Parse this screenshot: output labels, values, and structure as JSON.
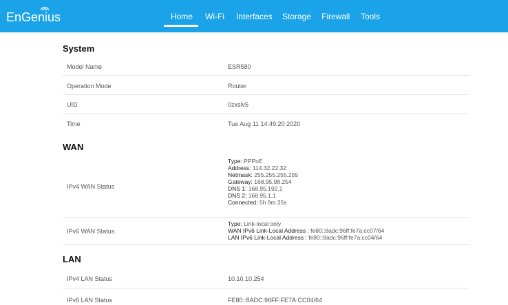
{
  "brand": {
    "logo_text": "EnGenius"
  },
  "nav": {
    "items": [
      {
        "label": "Home"
      },
      {
        "label": "Wi-Fi"
      },
      {
        "label": "Interfaces"
      },
      {
        "label": "Storage"
      },
      {
        "label": "Firewall"
      },
      {
        "label": "Tools"
      }
    ],
    "active": "Home"
  },
  "system": {
    "title": "System",
    "rows": [
      {
        "label": "Model Name",
        "value": "ESR580"
      },
      {
        "label": "Operation Mode",
        "value": "Router"
      },
      {
        "label": "UID",
        "value": "0zxslv5"
      },
      {
        "label": "Time",
        "value": "Tue Aug 11 14:49:20 2020"
      }
    ]
  },
  "wan": {
    "title": "WAN",
    "ipv4": {
      "label": "IPv4 WAN Status",
      "lines": [
        {
          "key": "Type:",
          "value": "PPPoE"
        },
        {
          "key": "Address:",
          "value": "114.32.22.32"
        },
        {
          "key": "Netmask:",
          "value": "255.255.255.255"
        },
        {
          "key": "Gateway:",
          "value": "168.95.98.254"
        },
        {
          "key": "DNS 1:",
          "value": "168.95.192.1"
        },
        {
          "key": "DNS 2:",
          "value": "168.95.1.1"
        },
        {
          "key": "Connected:",
          "value": "5h 9m 35s"
        }
      ]
    },
    "ipv6": {
      "label": "IPv6 WAN Status",
      "lines": [
        {
          "key": "Type:",
          "value": "Link-local only"
        },
        {
          "key": "WAN IPv6 Link-Local Address :",
          "value": "fe80::8adc:96ff:fe7a:cc07/64"
        },
        {
          "key": "LAN IPv6 Link-Local Address :",
          "value": "fe80::8adc:96ff:fe7a:cc04/64"
        }
      ]
    }
  },
  "lan": {
    "title": "LAN",
    "rows": [
      {
        "label": "IPv4 LAN Status",
        "value": "10.10.10.254"
      },
      {
        "label": "IPv6 LAN Status",
        "value": "FE80::8ADC:96FF:FE7A:CC04/64"
      }
    ]
  },
  "colors": {
    "header_bg": "#1aa3e8",
    "header_text": "#ffffff",
    "divider": "#e4e4e4"
  },
  "icons": {
    "logo_mark": "wifi-wave-icon"
  }
}
